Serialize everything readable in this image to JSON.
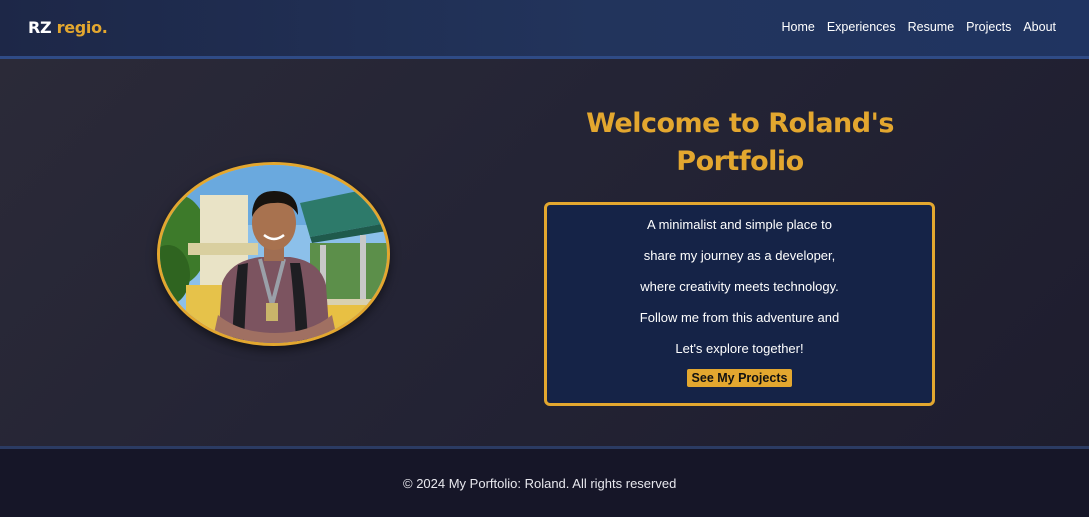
{
  "header": {
    "logo_prefix": "RZ",
    "logo_name": "regio.",
    "nav": [
      {
        "label": "Home"
      },
      {
        "label": "Experiences"
      },
      {
        "label": "Resume"
      },
      {
        "label": "Projects"
      },
      {
        "label": "About"
      }
    ]
  },
  "hero": {
    "title_line1": "Welcome to Roland's",
    "title_line2": "Portfolio",
    "intro_lines": [
      "A minimalist and simple place to",
      "share my journey as a developer,",
      "where creativity meets technology.",
      "Follow me from this adventure and",
      "Let's explore together!"
    ],
    "cta_label": "See My Projects",
    "profile_photo": "profile-photo"
  },
  "footer": {
    "copyright": "© 2024 My Porftolio: Roland. All rights reserved"
  },
  "colors": {
    "accent": "#e3a72f",
    "navbar": "#22345c",
    "intro_box": "#152347",
    "background": "#242435",
    "footer": "#161628"
  }
}
